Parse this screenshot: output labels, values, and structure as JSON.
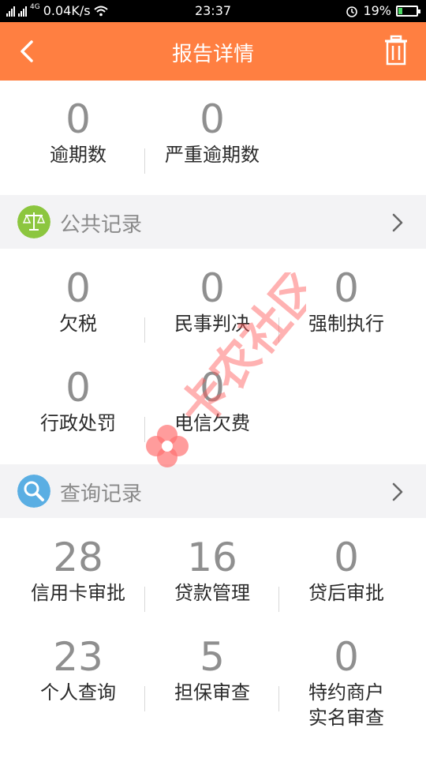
{
  "status_bar": {
    "network": "4G",
    "speed": "0.04K/s",
    "time": "23:37",
    "battery_percent": "19%",
    "battery_level": 0.19,
    "icons": [
      "signal-icon",
      "wifi-icon",
      "alarm-icon",
      "battery-icon"
    ]
  },
  "header": {
    "title": "报告详情",
    "back_icon": "chevron-left-icon",
    "action_icon": "trash-icon",
    "bg_color": "#ff7f41"
  },
  "overdue": [
    {
      "value": "0",
      "label": "逾期数"
    },
    {
      "value": "0",
      "label": "严重逾期数"
    }
  ],
  "public_records": {
    "title": "公共记录",
    "icon": "scales-icon",
    "icon_color": "#8cc63f",
    "items": [
      {
        "value": "0",
        "label": "欠税"
      },
      {
        "value": "0",
        "label": "民事判决"
      },
      {
        "value": "0",
        "label": "强制执行"
      },
      {
        "value": "0",
        "label": "行政处罚"
      },
      {
        "value": "0",
        "label": "电信欠费"
      }
    ]
  },
  "query_records": {
    "title": "查询记录",
    "icon": "search-icon",
    "icon_color": "#5aaee3",
    "items": [
      {
        "value": "28",
        "label": "信用卡审批"
      },
      {
        "value": "16",
        "label": "贷款管理"
      },
      {
        "value": "0",
        "label": "贷后审批"
      },
      {
        "value": "23",
        "label": "个人查询"
      },
      {
        "value": "5",
        "label": "担保审查"
      },
      {
        "value": "0",
        "label": "特约商户",
        "label2": "实名审查"
      }
    ]
  },
  "watermark": {
    "text": "卡农社区",
    "color": "#ff5a5a"
  }
}
